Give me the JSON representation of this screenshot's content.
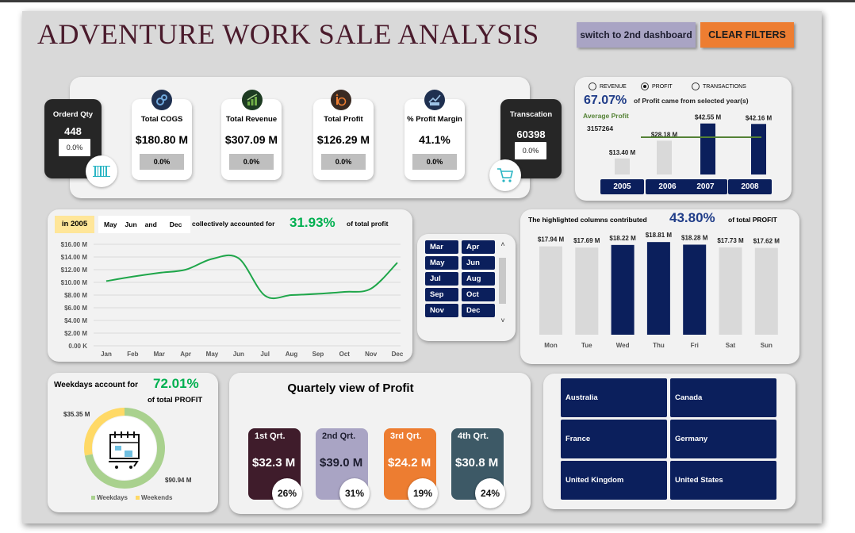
{
  "title": "ADVENTURE WORK SALE ANALYSIS",
  "buttons": {
    "switch_label": "switch to 2nd dashboard",
    "clear_label": "CLEAR FILTERS"
  },
  "kpis": {
    "order_qty": {
      "label": "Orderd Qty",
      "value": "448",
      "pct": "0.0%"
    },
    "cogs": {
      "label": "Total COGS",
      "value": "$180.80 M",
      "pct": "0.0%",
      "icon": "gears-icon"
    },
    "revenue": {
      "label": "Total Revenue",
      "value": "$307.09 M",
      "pct": "0.0%",
      "icon": "growth-chart-icon"
    },
    "profit": {
      "label": "Total Profit",
      "value": "$126.29 M",
      "pct": "0.0%",
      "icon": "money-growth-icon"
    },
    "margin": {
      "label": "% Profit Margin",
      "value": "41.1%",
      "pct": "0.0%",
      "icon": "profit-chart-icon"
    },
    "transactions": {
      "label": "Transcation",
      "value": "60398",
      "pct": "0.0%"
    },
    "bottom_icons": [
      "barcode-icon",
      "shopping-cart-icon"
    ]
  },
  "year_panel": {
    "radios": [
      "REVENUE",
      "PROFIT",
      "TRANSACTIONS"
    ],
    "selected_radio": "PROFIT",
    "headline_pct": "67.07%",
    "headline_text": "of  Profit came from selected year(s)",
    "avg_label": "Average Profit",
    "avg_value": "3157264",
    "avg_color": "#548235",
    "years": [
      "2005",
      "2006",
      "2007",
      "2008"
    ],
    "chart_data": {
      "type": "bar",
      "categories": [
        "2005",
        "2006",
        "2007",
        "2008"
      ],
      "values": [
        13.4,
        28.18,
        42.55,
        42.16
      ],
      "labels": [
        "$13.40 M",
        "$28.18 M",
        "$42.55 M",
        "$42.16 M"
      ],
      "highlighted": [
        "2007",
        "2008"
      ],
      "colors": {
        "highlight": "#0b1f5c",
        "base": "#d9d9d9"
      }
    }
  },
  "monthly_panel": {
    "year_tag": "in 2005",
    "months_shown": [
      "May",
      "Jun",
      "and",
      "Dec"
    ],
    "text": "collectively accounted for",
    "pct": "31.93%",
    "suffix": "of total profit",
    "chart_data": {
      "type": "line",
      "x": [
        "Jan",
        "Feb",
        "Mar",
        "Apr",
        "May",
        "Jun",
        "Jul",
        "Aug",
        "Sep",
        "Oct",
        "Nov",
        "Dec"
      ],
      "values": [
        10.2,
        10.9,
        11.5,
        12.0,
        13.7,
        13.8,
        7.9,
        8.0,
        8.2,
        8.5,
        9.0,
        13.1
      ],
      "yticks": [
        "$16.00 M",
        "$14.00 M",
        "$12.00 M",
        "$10.00 M",
        "$8.00 M",
        "$6.00 M",
        "$4.00 M",
        "$2.00 M",
        "0.00 K"
      ],
      "ylim": [
        0,
        16
      ],
      "grid": true,
      "color": "#1fa64a"
    }
  },
  "month_slicer": {
    "items": [
      "Mar",
      "Apr",
      "May",
      "Jun",
      "Jul",
      "Aug",
      "Sep",
      "Oct",
      "Nov",
      "Dec"
    ]
  },
  "weekday_panel": {
    "headline_text": "The highlighted columns contributed",
    "pct": "43.80%",
    "suffix": "of total PROFIT",
    "chart_data": {
      "type": "bar",
      "categories": [
        "Mon",
        "Tue",
        "Wed",
        "Thu",
        "Fri",
        "Sat",
        "Sun"
      ],
      "values": [
        17.94,
        17.69,
        18.22,
        18.81,
        18.28,
        17.73,
        17.62
      ],
      "labels": [
        "$17.94 M",
        "$17.69 M",
        "$18.22 M",
        "$18.81 M",
        "$18.28 M",
        "$17.73 M",
        "$17.62 M"
      ],
      "highlighted": [
        "Wed",
        "Thu",
        "Fri"
      ],
      "colors": {
        "highlight": "#0b1f5c",
        "base": "#d9d9d9"
      }
    }
  },
  "donut_panel": {
    "headline": "Weekdays account for",
    "pct": "72.01%",
    "suffix": "of total PROFIT",
    "chart_data": {
      "type": "pie",
      "categories": [
        "Weekdays",
        "Weekends"
      ],
      "values": [
        90.94,
        35.35
      ],
      "labels": [
        "$90.94 M",
        "$35.35 M"
      ],
      "colors": [
        "#a9d18e",
        "#ffd966"
      ]
    },
    "legend": [
      "Weekdays",
      "Weekends"
    ],
    "icon": "calendar-cart-icon"
  },
  "quarter_panel": {
    "title": "Quartely view of Profit",
    "quarters": [
      {
        "label": "1st Qrt.",
        "value": "$32.3 M",
        "pct": "26%",
        "color": "#3f1c2b"
      },
      {
        "label": "2nd Qrt.",
        "value": "$39.0 M",
        "pct": "31%",
        "color": "#a9a4c4"
      },
      {
        "label": "3rd Qrt.",
        "value": "$24.2 M",
        "pct": "19%",
        "color": "#ed7d31"
      },
      {
        "label": "4th Qrt.",
        "value": "$30.8 M",
        "pct": "24%",
        "color": "#3d5966"
      }
    ]
  },
  "country_slicer": {
    "items": [
      "Australia",
      "Canada",
      "France",
      "Germany",
      "United Kingdom",
      "United States"
    ]
  }
}
